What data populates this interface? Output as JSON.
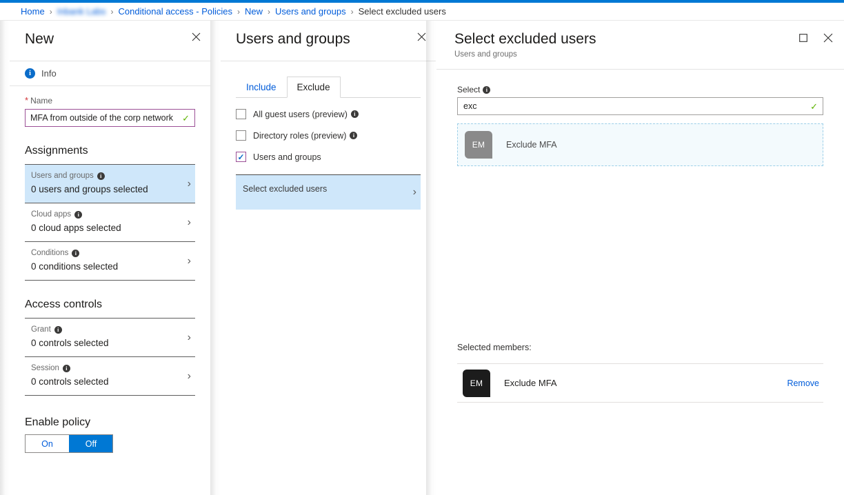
{
  "theme": {
    "accent": "#0078d4",
    "link": "#015cda",
    "selected_row": "#cfe7fa",
    "valid_border": "#9b4f96",
    "valid_check": "#5db300",
    "avatar_gray": "#8a8a8a",
    "avatar_dark": "#1c1c1c"
  },
  "breadcrumb": {
    "items": [
      {
        "label": "Home",
        "type": "link"
      },
      {
        "label": "Inbank Labs",
        "type": "redacted"
      },
      {
        "label": "Conditional access - Policies",
        "type": "link"
      },
      {
        "label": "New",
        "type": "link"
      },
      {
        "label": "Users and groups",
        "type": "link"
      },
      {
        "label": "Select excluded users",
        "type": "current"
      }
    ],
    "separator": "›"
  },
  "blade_new": {
    "title": "New",
    "close_icon": "close-icon",
    "info": {
      "icon": "info-icon",
      "label": "Info"
    },
    "name_field": {
      "label": "Name",
      "required_marker": "*",
      "value": "MFA from outside of the corp network",
      "placeholder": "",
      "validation_icon": "checkmark-icon"
    },
    "assignments": {
      "title": "Assignments",
      "items": [
        {
          "label": "Users and groups",
          "value": "0 users and groups selected",
          "selected": true,
          "info_icon": "info-icon",
          "chevron": "chevron-right-icon"
        },
        {
          "label": "Cloud apps",
          "value": "0 cloud apps selected",
          "selected": false,
          "info_icon": "info-icon",
          "chevron": "chevron-right-icon"
        },
        {
          "label": "Conditions",
          "value": "0 conditions selected",
          "selected": false,
          "info_icon": "info-icon",
          "chevron": "chevron-right-icon"
        }
      ]
    },
    "access_controls": {
      "title": "Access controls",
      "items": [
        {
          "label": "Grant",
          "value": "0 controls selected",
          "selected": false,
          "info_icon": "info-icon",
          "chevron": "chevron-right-icon"
        },
        {
          "label": "Session",
          "value": "0 controls selected",
          "selected": false,
          "info_icon": "info-icon",
          "chevron": "chevron-right-icon"
        }
      ]
    },
    "enable_policy": {
      "title": "Enable policy",
      "on_label": "On",
      "off_label": "Off",
      "selected": "Off"
    }
  },
  "blade_users": {
    "title": "Users and groups",
    "close_icon": "close-icon",
    "tabs": [
      {
        "label": "Include",
        "active": false
      },
      {
        "label": "Exclude",
        "active": true
      }
    ],
    "checkboxes": [
      {
        "label": "All guest users (preview)",
        "checked": false,
        "has_info": true
      },
      {
        "label": "Directory roles (preview)",
        "checked": false,
        "has_info": true
      },
      {
        "label": "Users and groups",
        "checked": true,
        "has_info": false
      }
    ],
    "picker": {
      "label": "Select excluded users",
      "chevron": "chevron-right-icon"
    }
  },
  "blade_select": {
    "title": "Select excluded users",
    "subtitle": "Users and groups",
    "maximize_icon": "maximize-icon",
    "close_icon": "close-icon",
    "select_field": {
      "label": "Select",
      "info_icon": "info-icon",
      "value": "exc",
      "placeholder": "",
      "validation_icon": "checkmark-icon"
    },
    "results": [
      {
        "initials": "EM",
        "name": "Exclude MFA"
      }
    ],
    "selected_members": {
      "label": "Selected members:",
      "items": [
        {
          "initials": "EM",
          "name": "Exclude MFA",
          "action_label": "Remove"
        }
      ]
    }
  }
}
